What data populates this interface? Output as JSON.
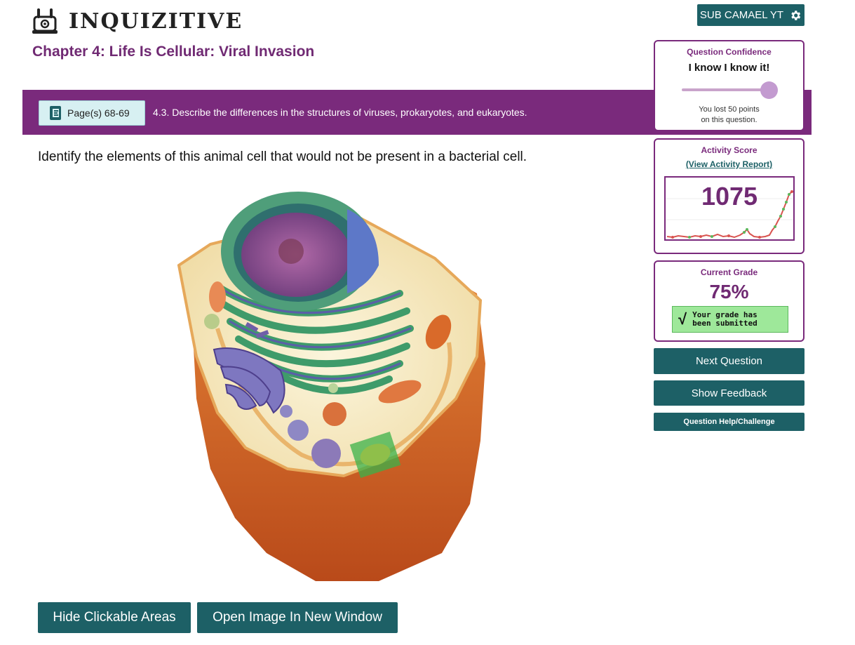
{
  "header": {
    "logo_text": "INQUIZITIVE",
    "user_label": "SUB CAMAEL YT"
  },
  "chapter": {
    "title": "Chapter 4: Life Is Cellular: Viral Invasion"
  },
  "banner": {
    "page_label": "Page(s) 68-69",
    "objective": "4.3. Describe the differences in the structures of viruses, prokaryotes, and eukaryotes."
  },
  "question": {
    "prompt": "Identify the elements of this animal cell that would not be present in a bacterial cell."
  },
  "buttons": {
    "hide_areas": "Hide Clickable Areas",
    "open_image": "Open Image In New Window",
    "next": "Next Question",
    "feedback": "Show Feedback",
    "help": "Question Help/Challenge"
  },
  "confidence": {
    "title": "Question Confidence",
    "value": "I know I know it!",
    "level": 1.0,
    "note_line1": "You lost 50 points",
    "note_line2": "on this question."
  },
  "activity": {
    "title": "Activity Score",
    "link": "(View Activity Report)",
    "score": "1075"
  },
  "grade": {
    "title": "Current Grade",
    "value": "75%",
    "status_line1": "Your grade has",
    "status_line2": "been submitted"
  },
  "colors": {
    "teal": "#1d6066",
    "purple": "#7a2a7c",
    "grade_green": "#9ee89a"
  },
  "icons": {
    "logo": "robot-logo-icon",
    "settings": "gear-icon",
    "book": "ebook-icon",
    "check": "check-icon"
  }
}
